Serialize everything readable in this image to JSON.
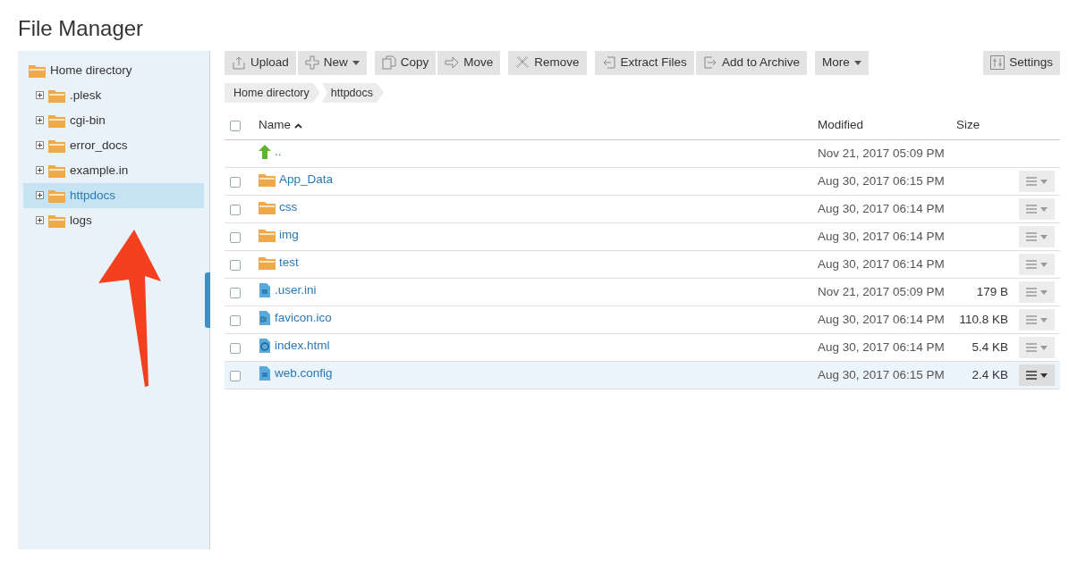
{
  "page_title": "File Manager",
  "sidebar": {
    "root": {
      "label": "Home directory",
      "children": [
        {
          "label": ".plesk",
          "selected": false
        },
        {
          "label": "cgi-bin",
          "selected": false
        },
        {
          "label": "error_docs",
          "selected": false
        },
        {
          "label": "example.in",
          "selected": false
        },
        {
          "label": "httpdocs",
          "selected": true
        },
        {
          "label": "logs",
          "selected": false
        }
      ]
    }
  },
  "toolbar": [
    [
      {
        "kind": "upload",
        "label": "Upload",
        "dropdown": false
      },
      {
        "kind": "new",
        "label": "New",
        "dropdown": true
      }
    ],
    [
      {
        "kind": "copy",
        "label": "Copy",
        "dropdown": false
      },
      {
        "kind": "move",
        "label": "Move",
        "dropdown": false
      }
    ],
    [
      {
        "kind": "remove",
        "label": "Remove",
        "dropdown": false
      }
    ],
    [
      {
        "kind": "extract",
        "label": "Extract Files",
        "dropdown": false
      },
      {
        "kind": "archive",
        "label": "Add to Archive",
        "dropdown": false
      }
    ],
    [
      {
        "kind": "plain",
        "label": "More",
        "dropdown": true
      }
    ]
  ],
  "settings_button": {
    "label": "Settings"
  },
  "select_all_checked": false,
  "breadcrumb": [
    "Home directory",
    "httpdocs"
  ],
  "table": {
    "columns": [
      {
        "label": "Name",
        "sorted": true
      },
      {
        "label": "Modified"
      },
      {
        "label": "Size"
      }
    ],
    "rows": [
      {
        "kind": "parent",
        "name": "..",
        "modified": "Nov 21, 2017 05:09 PM",
        "selected": false
      },
      {
        "kind": "folder",
        "name": "App_Data",
        "modified": "Aug 30, 2017 06:15 PM",
        "checked": false,
        "selected": false
      },
      {
        "kind": "folder",
        "name": "css",
        "modified": "Aug 30, 2017 06:14 PM",
        "checked": false,
        "selected": false
      },
      {
        "kind": "folder",
        "name": "img",
        "modified": "Aug 30, 2017 06:14 PM",
        "checked": false,
        "selected": false
      },
      {
        "kind": "folder",
        "name": "test",
        "modified": "Aug 30, 2017 06:14 PM",
        "checked": false,
        "selected": false
      },
      {
        "kind": "file",
        "name": ".user.ini",
        "modified": "Nov 21, 2017 05:09 PM",
        "size": "179 B",
        "checked": false,
        "selected": false
      },
      {
        "kind": "binary",
        "name": "favicon.ico",
        "modified": "Aug 30, 2017 06:14 PM",
        "size": "110.8 KB",
        "checked": false,
        "selected": false
      },
      {
        "kind": "web",
        "name": "index.html",
        "modified": "Aug 30, 2017 06:14 PM",
        "size": "5.4 KB",
        "checked": false,
        "selected": false
      },
      {
        "kind": "file",
        "name": "web.config",
        "modified": "Aug 30, 2017 06:15 PM",
        "size": "2.4 KB",
        "checked": false,
        "selected": true
      }
    ]
  }
}
